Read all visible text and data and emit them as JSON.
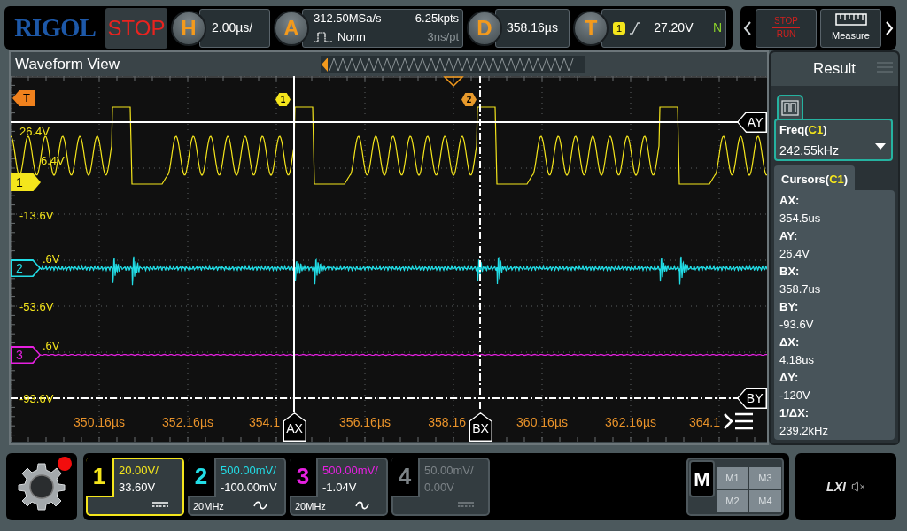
{
  "top_bar": {
    "logo": "RIGOL",
    "run_state": "STOP",
    "horizontal": {
      "key": "H",
      "scale": "2.00µs/"
    },
    "acquisition": {
      "key": "A",
      "sample_rate": "312.50MSa/s",
      "memory_depth": "6.25kpts",
      "mode": "Norm",
      "resolution": "3ns/pt"
    },
    "delay": {
      "key": "D",
      "value": "358.16µs"
    },
    "trigger": {
      "key": "T",
      "source": "1",
      "level": "27.20V",
      "sweep": "N"
    },
    "run_stop_button": {
      "top": "STOP",
      "bottom": "RUN"
    },
    "measure_button": "Measure"
  },
  "waveform_view": {
    "title": "Waveform View",
    "trigger_marker": "T",
    "y_labels": [
      "26.4V",
      "6.4V",
      "-13.6V",
      ".6V",
      "-53.6V",
      ".6V",
      "-93.6V"
    ],
    "x_labels": [
      "350.16µs",
      "352.16µs",
      "354.1",
      "356.16µs",
      "358.16",
      "360.16µs",
      "362.16µs",
      "364.1"
    ],
    "position_markers": [
      "1",
      "2"
    ],
    "channel_markers": [
      {
        "label": "1",
        "selected": true
      },
      {
        "label": "2",
        "selected": false
      },
      {
        "label": "3",
        "selected": false
      }
    ],
    "cursor_labels": {
      "ax": "AX",
      "bx": "BX",
      "ay": "AY",
      "by": "BY"
    }
  },
  "result": {
    "title": "Result",
    "measurement": {
      "name": "Freq(",
      "source": "C1",
      "close": ")",
      "value": "242.55kHz"
    },
    "cursors": {
      "name": "Cursors(",
      "source": "C1",
      "close": ")",
      "items": [
        {
          "label": "AX:",
          "value": "354.5us"
        },
        {
          "label": "AY:",
          "value": "26.4V"
        },
        {
          "label": "BX:",
          "value": "358.7us"
        },
        {
          "label": "BY:",
          "value": "-93.6V"
        },
        {
          "label": "ΔX:",
          "value": "4.18us"
        },
        {
          "label": "ΔY:",
          "value": "-120V"
        },
        {
          "label": "1/ΔX:",
          "value": "239.2kHz"
        }
      ]
    }
  },
  "channels": [
    {
      "number": "1",
      "color": "#f4e51c",
      "scale": "20.00V/",
      "offset": "33.60V",
      "kind": "dc",
      "selected": true,
      "enabled": true
    },
    {
      "number": "2",
      "color": "#22dde6",
      "scale": "500.00mV/",
      "offset": "-100.00mV",
      "bandwidth": "20MHz",
      "kind": "ac",
      "selected": false,
      "enabled": true
    },
    {
      "number": "3",
      "color": "#e620e0",
      "scale": "500.00mV/",
      "offset": "-1.04V",
      "bandwidth": "20MHz",
      "kind": "ac",
      "selected": false,
      "enabled": true
    },
    {
      "number": "4",
      "scale": "50.00mV/",
      "offset": "0.00V",
      "kind": "dc",
      "selected": false,
      "enabled": false
    }
  ],
  "math": {
    "label": "M",
    "slots": [
      "M1",
      "M3",
      "M2",
      "M4"
    ]
  },
  "status": {
    "lxi": "LXI"
  }
}
